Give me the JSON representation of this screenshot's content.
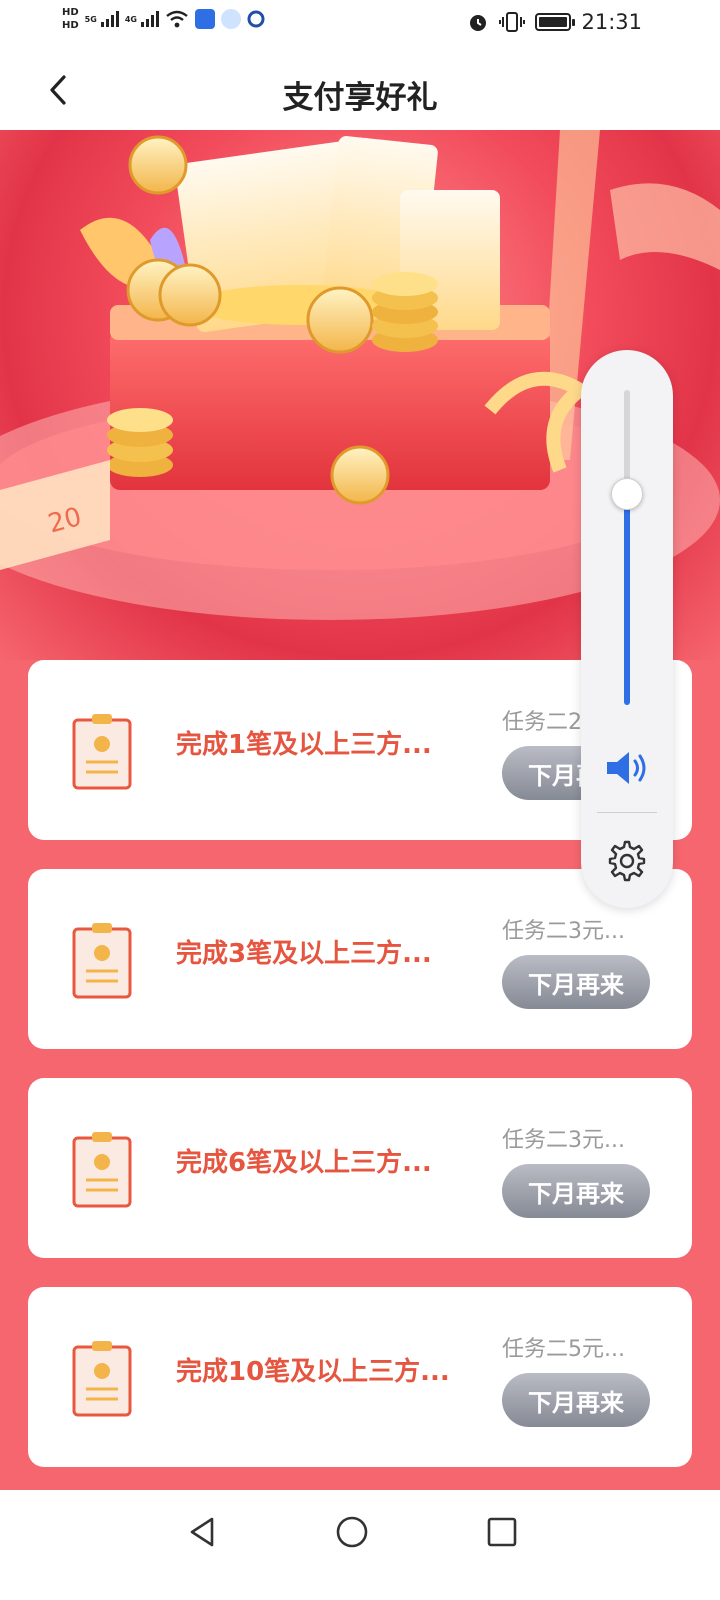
{
  "status_bar": {
    "network_labels": [
      "HD",
      "HD"
    ],
    "net_5g": "5G",
    "net_4g": "4G",
    "time": "21:31"
  },
  "header": {
    "title": "支付享好礼"
  },
  "tasks": [
    {
      "title": "完成1笔及以上三方...",
      "reward": "任务二2元...",
      "button": "下月再来"
    },
    {
      "title": "完成3笔及以上三方...",
      "reward": "任务二3元...",
      "button": "下月再来"
    },
    {
      "title": "完成6笔及以上三方...",
      "reward": "任务二3元...",
      "button": "下月再来"
    },
    {
      "title": "完成10笔及以上三方...",
      "reward": "任务二5元...",
      "button": "下月再来"
    }
  ],
  "volume": {
    "level": 0.67,
    "accent_color": "#2f6fe6"
  },
  "banner": {
    "ticket_text": "20"
  },
  "icons": [
    "back-icon",
    "speaker-icon",
    "gear-icon",
    "back-triangle-icon",
    "home-circle-icon",
    "recents-square-icon",
    "alarm-icon",
    "vibrate-icon",
    "wifi-icon",
    "battery-icon"
  ]
}
